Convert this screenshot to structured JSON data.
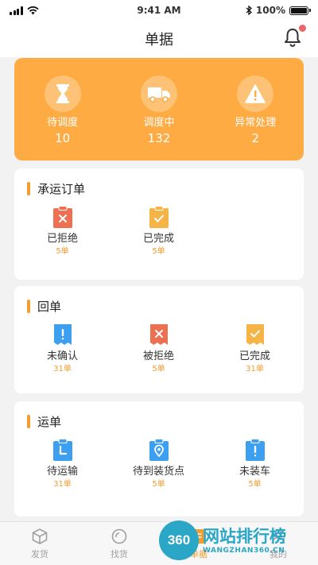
{
  "status_bar": {
    "time": "9:41 AM",
    "battery": "100%"
  },
  "nav": {
    "title": "单据"
  },
  "colors": {
    "accent": "#fdab42",
    "accent_dark": "#f39c2f",
    "blue": "#3d9ff0",
    "red": "#ed7052",
    "yellow": "#f5b546",
    "badge": "#f06666"
  },
  "stats": [
    {
      "icon": "hourglass-icon",
      "label": "待调度",
      "value": "10"
    },
    {
      "icon": "truck-icon",
      "label": "调度中",
      "value": "132"
    },
    {
      "icon": "warning-icon",
      "label": "异常处理",
      "value": "2"
    }
  ],
  "sections": [
    {
      "title": "承运订单",
      "items": [
        {
          "icon": "rejected-order-icon",
          "label": "已拒绝",
          "count": "5单"
        },
        {
          "icon": "completed-order-icon",
          "label": "已完成",
          "count": "5单"
        }
      ]
    },
    {
      "title": "回单",
      "items": [
        {
          "icon": "unconfirmed-receipt-icon",
          "label": "未确认",
          "count": "31单"
        },
        {
          "icon": "rejected-receipt-icon",
          "label": "被拒绝",
          "count": "5单"
        },
        {
          "icon": "completed-receipt-icon",
          "label": "已完成",
          "count": "31单"
        }
      ]
    },
    {
      "title": "运单",
      "items": [
        {
          "icon": "pending-transport-icon",
          "label": "待运输",
          "count": "31单"
        },
        {
          "icon": "to-loading-point-icon",
          "label": "待到装货点",
          "count": "5单"
        },
        {
          "icon": "not-loaded-icon",
          "label": "未装车",
          "count": "5单"
        }
      ]
    }
  ],
  "tabs": [
    {
      "label": "发货",
      "icon": "cube-icon"
    },
    {
      "label": "找货",
      "icon": "search-cargo-icon"
    },
    {
      "label": "单据",
      "icon": "documents-icon",
      "active": true
    },
    {
      "label": "我的",
      "icon": "profile-icon"
    }
  ],
  "watermark": {
    "badge": "360",
    "name": "网站排行榜",
    "url": "WANGZHAN360.CN"
  }
}
